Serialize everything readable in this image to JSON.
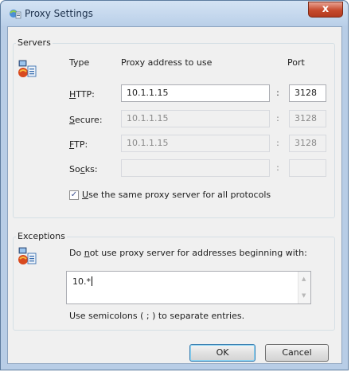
{
  "window": {
    "title": "Proxy Settings",
    "close_label": "x",
    "colors": {
      "frame": "#b8cde6",
      "client": "#f0f0f0",
      "close": "#c64a2d"
    }
  },
  "servers": {
    "group_label": "Servers",
    "icon": "network-computer-icon",
    "headers": {
      "type": "Type",
      "address": "Proxy address to use",
      "port": "Port"
    },
    "rows": [
      {
        "key": "http",
        "label": "HTTP:",
        "underline_char": "H",
        "rest": "TTP:",
        "address": "10.1.1.15",
        "port": "3128",
        "enabled": true
      },
      {
        "key": "secure",
        "label": "Secure:",
        "underline_char": "S",
        "rest": "ecure:",
        "address": "10.1.1.15",
        "port": "3128",
        "enabled": false
      },
      {
        "key": "ftp",
        "label": "FTP:",
        "underline_char": "F",
        "rest": "TP:",
        "address": "10.1.1.15",
        "port": "3128",
        "enabled": false
      },
      {
        "key": "socks",
        "label": "Socks:",
        "prefix": "So",
        "underline_char": "c",
        "rest": "ks:",
        "address": "",
        "port": "",
        "enabled": false
      }
    ],
    "separator": ":",
    "same_proxy": {
      "checked": true,
      "label": "Use the same proxy server for all protocols",
      "underline_char": "U",
      "rest": "se the same proxy server for all protocols"
    }
  },
  "exceptions": {
    "group_label": "Exceptions",
    "icon": "network-computer-icon",
    "instruction": {
      "prefix": "Do ",
      "underline_char": "n",
      "rest": "ot use proxy server for addresses beginning with:"
    },
    "value": "10.*",
    "hint": "Use semicolons ( ; ) to separate entries."
  },
  "buttons": {
    "ok": "OK",
    "cancel": "Cancel"
  }
}
